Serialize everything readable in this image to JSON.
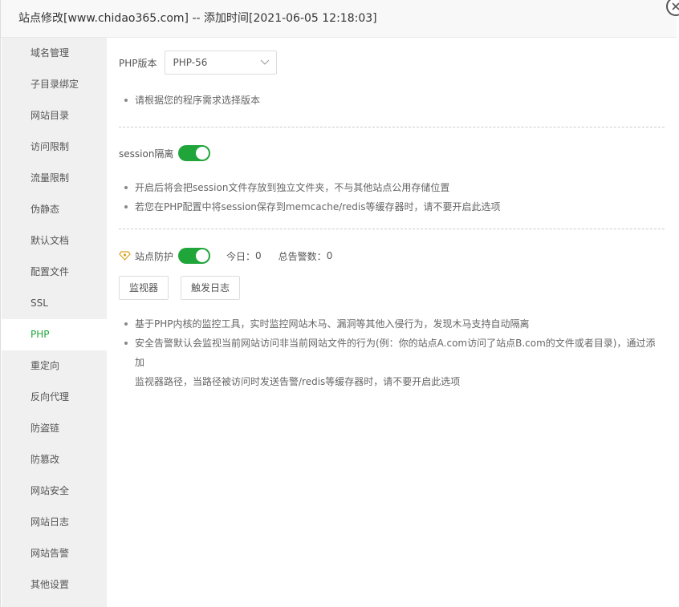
{
  "window": {
    "title": "站点修改[www.chidao365.com] -- 添加时间[2021-06-05 12:18:03]"
  },
  "sidebar": {
    "items": [
      {
        "label": "域名管理"
      },
      {
        "label": "子目录绑定"
      },
      {
        "label": "网站目录"
      },
      {
        "label": "访问限制"
      },
      {
        "label": "流量限制"
      },
      {
        "label": "伪静态"
      },
      {
        "label": "默认文档"
      },
      {
        "label": "配置文件"
      },
      {
        "label": "SSL"
      },
      {
        "label": "PHP",
        "active": true
      },
      {
        "label": "重定向"
      },
      {
        "label": "反向代理"
      },
      {
        "label": "防盗链"
      },
      {
        "label": "防篡改"
      },
      {
        "label": "网站安全"
      },
      {
        "label": "网站日志"
      },
      {
        "label": "网站告警"
      },
      {
        "label": "其他设置"
      }
    ]
  },
  "php": {
    "label": "PHP版本",
    "selected": "PHP-56",
    "tips": [
      "请根据您的程序需求选择版本"
    ]
  },
  "session": {
    "label": "session隔离",
    "enabled": true,
    "tips": [
      "开启后将会把session文件存放到独立文件夹，不与其他站点公用存储位置",
      "若您在PHP配置中将session保存到memcache/redis等缓存器时，请不要开启此选项"
    ]
  },
  "protection": {
    "label": "站点防护",
    "enabled": true,
    "today_label": "今日：",
    "today_value": "0",
    "total_label": "总告警数：",
    "total_value": "0",
    "monitor_button": "监视器",
    "log_button": "触发日志",
    "tips": [
      "基于PHP内核的监控工具，实时监控网站木马、漏洞等其他入侵行为，发现木马支持自动隔离",
      "安全告警默认会监视当前网站访问非当前网站文件的行为(例：你的站点A.com访问了站点B.com的文件或者目录)，通过添加",
      "监视器路径，当路径被访问时发送告警/redis等缓存器时，请不要开启此选项"
    ]
  },
  "colors": {
    "accent": "#20a53a",
    "sidebar_bg": "#f0f0f0",
    "title_bg": "#f8f8f8"
  },
  "icons": {
    "close": "close-icon",
    "select": "chevron-down-icon",
    "protection": "diamond-shield-icon"
  }
}
